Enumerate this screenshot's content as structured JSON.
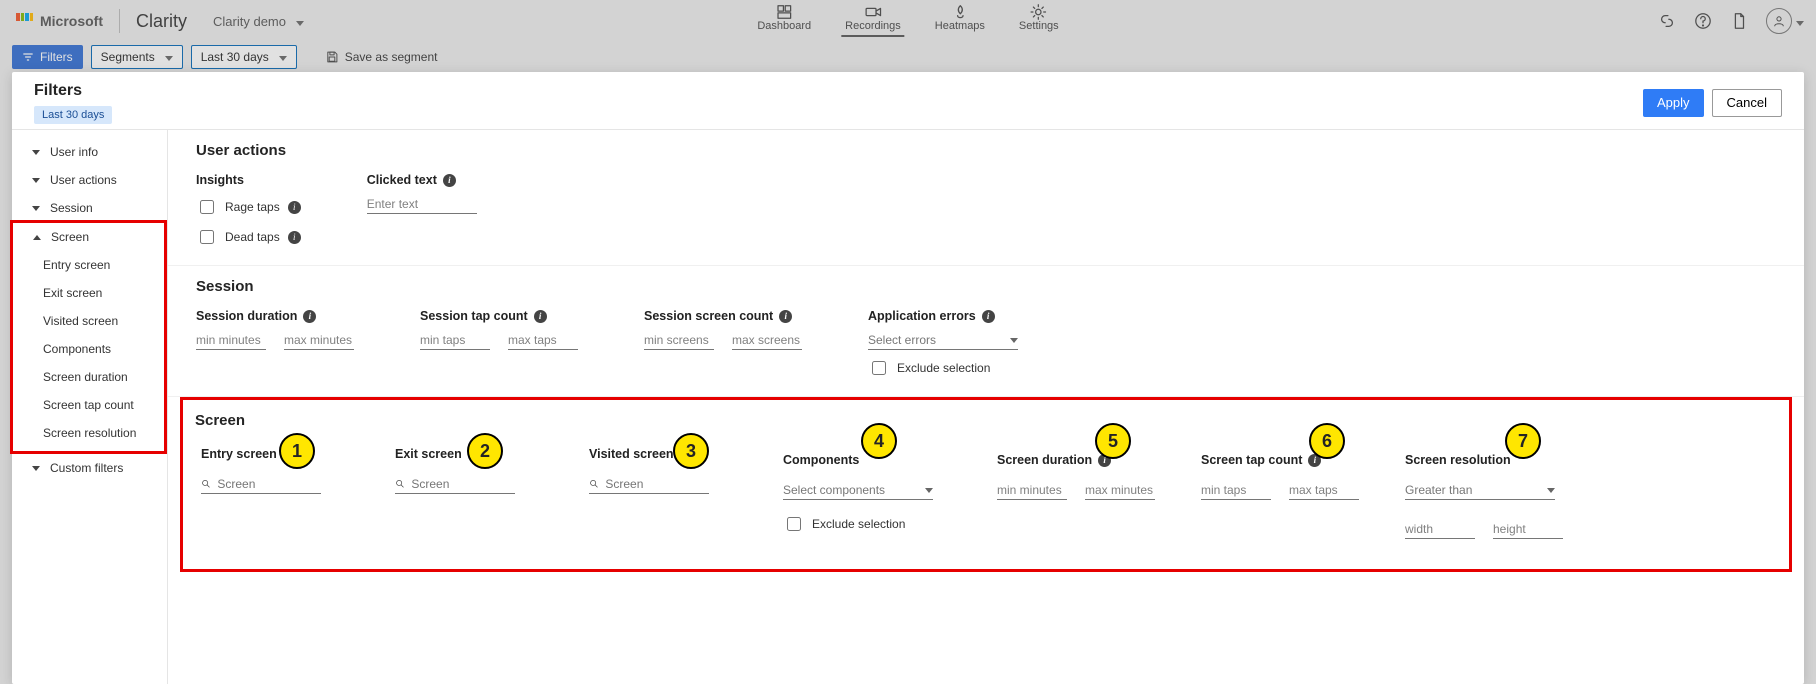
{
  "brand": {
    "ms": "Microsoft",
    "product": "Clarity",
    "project": "Clarity demo"
  },
  "nav": {
    "dashboard": "Dashboard",
    "recordings": "Recordings",
    "heatmaps": "Heatmaps",
    "settings": "Settings"
  },
  "subbar": {
    "filters": "Filters",
    "segments": "Segments",
    "date": "Last 30 days",
    "save_as_segment": "Save as segment"
  },
  "panel": {
    "title": "Filters",
    "apply": "Apply",
    "cancel": "Cancel",
    "chip_date": "Last 30 days"
  },
  "side": {
    "user_info": "User info",
    "user_actions": "User actions",
    "session": "Session",
    "screen": "Screen",
    "entry_screen": "Entry screen",
    "exit_screen": "Exit screen",
    "visited_screen": "Visited screen",
    "components": "Components",
    "screen_duration": "Screen duration",
    "screen_tap_count": "Screen tap count",
    "screen_resolution": "Screen resolution",
    "custom_filters": "Custom filters"
  },
  "user_actions": {
    "heading": "User actions",
    "insights": "Insights",
    "rage_taps": "Rage taps",
    "dead_taps": "Dead taps",
    "clicked_text": "Clicked text",
    "clicked_text_ph": "Enter text"
  },
  "session": {
    "heading": "Session",
    "duration": "Session duration",
    "tap_count": "Session tap count",
    "screen_count": "Session screen count",
    "app_errors": "Application errors",
    "min_minutes": "min minutes",
    "max_minutes": "max minutes",
    "min_taps": "min taps",
    "max_taps": "max taps",
    "min_screens": "min screens",
    "max_screens": "max screens",
    "select_errors": "Select errors",
    "exclude": "Exclude selection"
  },
  "screen": {
    "heading": "Screen",
    "entry": "Entry screen",
    "exit": "Exit screen",
    "visited": "Visited screen",
    "components": "Components",
    "select_components": "Select components",
    "exclude": "Exclude selection",
    "duration": "Screen duration",
    "tap_count": "Screen tap count",
    "resolution": "Screen resolution",
    "screen_ph": "Screen",
    "min_minutes": "min minutes",
    "max_minutes": "max minutes",
    "min_taps": "min taps",
    "max_taps": "max taps",
    "greater_than": "Greater than",
    "width": "width",
    "height": "height"
  },
  "badges": {
    "1": "1",
    "2": "2",
    "3": "3",
    "4": "4",
    "5": "5",
    "6": "6",
    "7": "7"
  }
}
